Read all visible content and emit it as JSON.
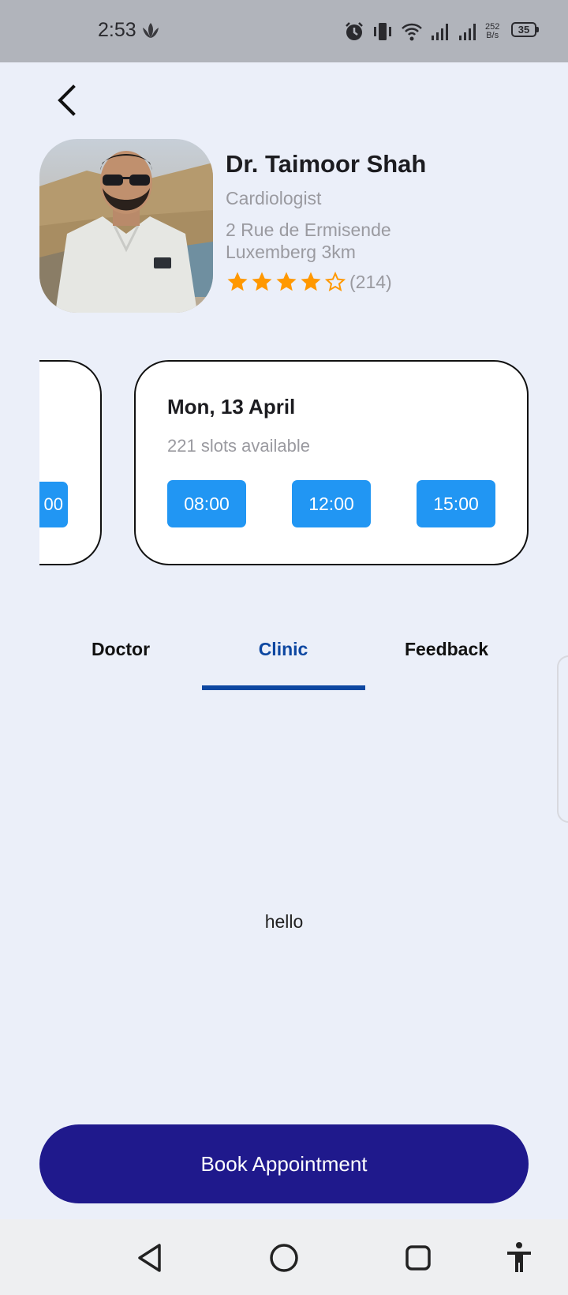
{
  "status_bar": {
    "time": "2:53",
    "net_speed_value": "252",
    "net_speed_unit": "B/s",
    "battery": "35",
    "icons": [
      "leaf-icon",
      "alarm-icon",
      "vibrate-icon",
      "wifi-icon",
      "signal-icon",
      "signal-icon"
    ]
  },
  "doctor": {
    "name": "Dr. Taimoor Shah",
    "specialty": "Cardiologist",
    "address_line1": "2 Rue de Ermisende",
    "address_line2": "Luxemberg 3km",
    "rating": 4,
    "rating_max": 5,
    "reviews": "(214)"
  },
  "slots": {
    "partial_card_time": "00",
    "date": "Mon, 13 April",
    "available": "221 slots available",
    "times": [
      "08:00",
      "12:00",
      "15:00"
    ]
  },
  "tabs": {
    "items": [
      "Doctor",
      "Clinic",
      "Feedback"
    ],
    "active": "Clinic"
  },
  "content": {
    "text": "hello"
  },
  "book_button": {
    "label": "Book Appointment"
  },
  "colors": {
    "accent_blue": "#2196f3",
    "tab_active": "#0d47a1",
    "primary_button": "#1f198c",
    "star": "#ff9800",
    "background": "#ebeff9"
  }
}
